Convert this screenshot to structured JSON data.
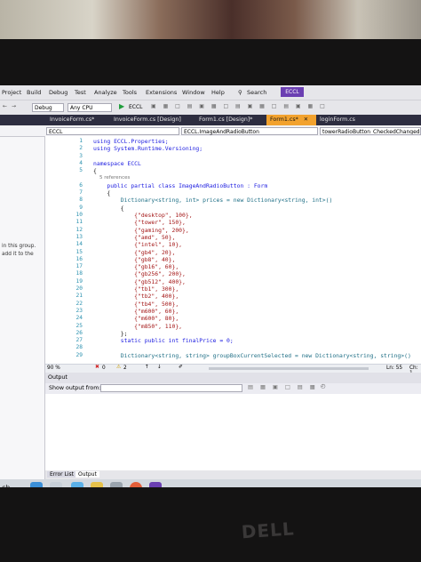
{
  "menu": {
    "items": [
      "Project",
      "Build",
      "Debug",
      "Test",
      "Analyze",
      "Tools",
      "Extensions",
      "Window",
      "Help"
    ],
    "search_label": "Search",
    "project_name": "ECCL"
  },
  "toolbar": {
    "config": "Debug",
    "platform": "Any CPU",
    "run_target": "ECCL"
  },
  "tabs": [
    "InvoiceForm.cs*",
    "InvoiceForm.cs [Design]",
    "Form1.cs [Design]*",
    "Form1.cs*",
    "loginForm.cs"
  ],
  "navbar": {
    "project": "ECCL",
    "class": "ECCL.ImageAndRadioButton",
    "member": "towerRadioButton_CheckedChanged(o"
  },
  "left_pane": {
    "line1": "in this group.",
    "line2": "add it to the"
  },
  "code_lines": [
    {
      "n": "1",
      "t": "using ECCL.Properties;"
    },
    {
      "n": "2",
      "t": "using System.Runtime.Versioning;"
    },
    {
      "n": "3",
      "t": ""
    },
    {
      "n": "4",
      "t": "namespace ECCL"
    },
    {
      "n": "5",
      "t": "{"
    },
    {
      "n": "",
      "t": "    5 references"
    },
    {
      "n": "6",
      "t": "    public partial class ImageAndRadioButton : Form"
    },
    {
      "n": "7",
      "t": "    {"
    },
    {
      "n": "8",
      "t": "        Dictionary<string, int> prices = new Dictionary<string, int>()"
    },
    {
      "n": "9",
      "t": "        {"
    },
    {
      "n": "10",
      "t": "            {\"desktop\", 100},"
    },
    {
      "n": "11",
      "t": "            {\"tower\", 150},"
    },
    {
      "n": "12",
      "t": "            {\"gaming\", 200},"
    },
    {
      "n": "13",
      "t": "            {\"amd\", 50},"
    },
    {
      "n": "14",
      "t": "            {\"intel\", 10},"
    },
    {
      "n": "15",
      "t": "            {\"gb4\", 20},"
    },
    {
      "n": "16",
      "t": "            {\"gb8\", 40},"
    },
    {
      "n": "17",
      "t": "            {\"gb16\", 60},"
    },
    {
      "n": "18",
      "t": "            {\"gb256\", 200},"
    },
    {
      "n": "19",
      "t": "            {\"gb512\", 400},"
    },
    {
      "n": "20",
      "t": "            {\"tb1\", 300},"
    },
    {
      "n": "21",
      "t": "            {\"tb2\", 400},"
    },
    {
      "n": "22",
      "t": "            {\"tb4\", 500},"
    },
    {
      "n": "23",
      "t": "            {\"m600\", 60},"
    },
    {
      "n": "24",
      "t": "            {\"m600\", 80},"
    },
    {
      "n": "25",
      "t": "            {\"m850\", 110},"
    },
    {
      "n": "26",
      "t": "        };"
    },
    {
      "n": "27",
      "t": "        static public int finalPrice = 0;"
    },
    {
      "n": "28",
      "t": ""
    },
    {
      "n": "29",
      "t": "        Dictionary<string, string> groupBoxCurrentSelected = new Dictionary<string, string>()"
    }
  ],
  "status": {
    "zoom": "90 %",
    "errors": "0",
    "warnings": "2",
    "position": "Ln: 55",
    "col": "Ch: 1"
  },
  "output": {
    "title": "Output",
    "show_from_label": "Show output from:"
  },
  "bottom_tabs": [
    "Error List",
    "Output"
  ],
  "taskbar": {
    "left_text": "ch"
  },
  "brand": "DELL"
}
